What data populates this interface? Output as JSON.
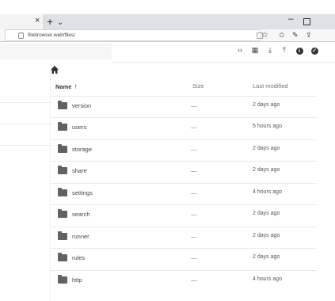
{
  "browser": {
    "close_glyph": "×",
    "new_tab_glyph": "+",
    "tab_dropdown_glyph": "⌄",
    "minimize_glyph": "–",
    "url": "filebrowser.web/files/",
    "toolbar_icons": [
      "star-icon",
      "reading-list-icon",
      "pen-icon",
      "share-icon"
    ]
  },
  "toolbar": {
    "actions": [
      {
        "icon": "code-icon",
        "glyph": "‹›"
      },
      {
        "icon": "grid-view-icon",
        "glyph": "▦"
      },
      {
        "icon": "download-icon",
        "glyph": "⤓"
      },
      {
        "icon": "upload-icon",
        "glyph": "⤒"
      },
      {
        "icon": "info-icon",
        "glyph": "i"
      },
      {
        "icon": "check-circle-icon",
        "glyph": "✓"
      }
    ]
  },
  "listing": {
    "columns": {
      "name": "Name",
      "size": "Size",
      "modified": "Last modified"
    },
    "sort_glyph": "↑",
    "rows": [
      {
        "name": "version",
        "size": "—",
        "modified": "2 days ago"
      },
      {
        "name": "users",
        "size": "—",
        "modified": "5 hours ago"
      },
      {
        "name": "storage",
        "size": "—",
        "modified": "2 days ago"
      },
      {
        "name": "share",
        "size": "—",
        "modified": "2 days ago"
      },
      {
        "name": "settings",
        "size": "—",
        "modified": "4 hours ago"
      },
      {
        "name": "search",
        "size": "—",
        "modified": "2 days ago"
      },
      {
        "name": "runner",
        "size": "—",
        "modified": "2 days ago"
      },
      {
        "name": "rules",
        "size": "—",
        "modified": "2 days ago"
      },
      {
        "name": "http",
        "size": "—",
        "modified": "4 hours ago"
      }
    ]
  }
}
